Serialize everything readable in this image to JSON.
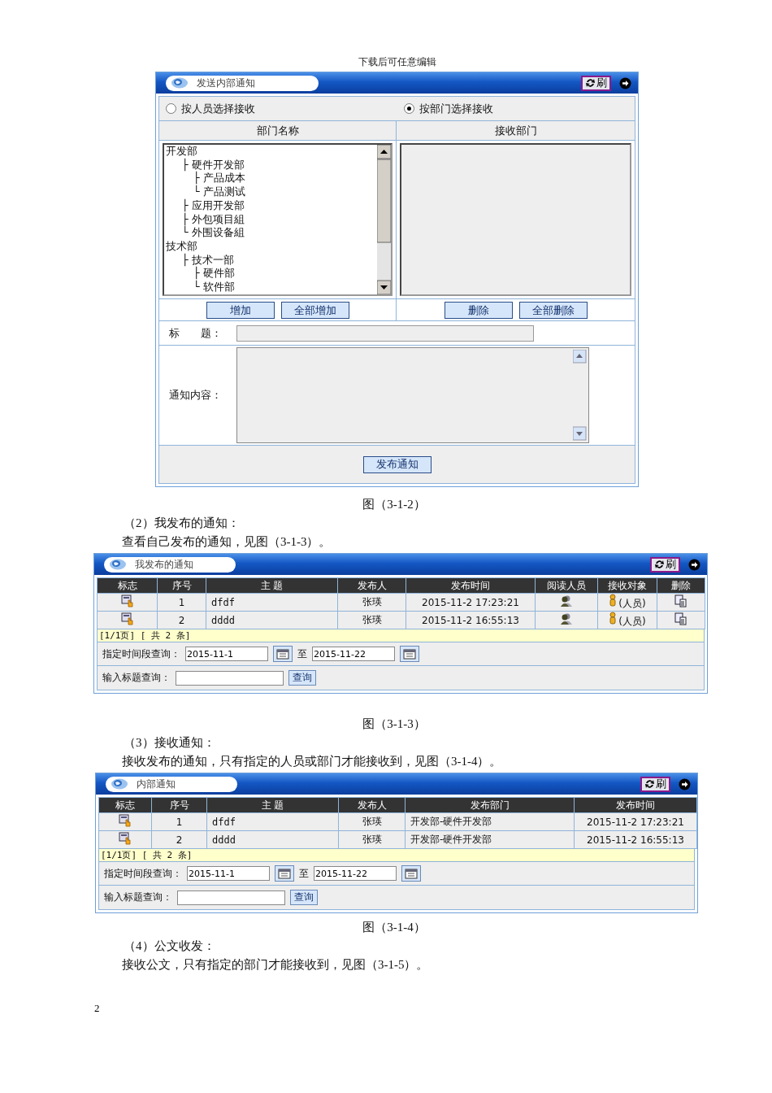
{
  "header_note": "下载后可任意编辑",
  "blocks": [
    {
      "kind": "send_form",
      "title": "发送内部通知",
      "refresh": "刷",
      "modes": [
        {
          "label": "按人员选择接收",
          "selected": false
        },
        {
          "label": "按部门选择接收",
          "selected": true
        }
      ],
      "columns": [
        "部门名称",
        "接收部门"
      ],
      "tree": [
        {
          "label": "开发部",
          "children": [
            {
              "label": "├ 硬件开发部",
              "children": [
                {
                  "label": "├ 产品成本"
                },
                {
                  "label": "└ 产品测试"
                }
              ]
            },
            {
              "label": "├ 应用开发部"
            },
            {
              "label": "├ 外包项目組"
            },
            {
              "label": "└ 外围设备組"
            }
          ]
        },
        {
          "label": "技术部",
          "children": [
            {
              "label": "├ 技术一部",
              "children": [
                {
                  "label": "├ 硬件部"
                },
                {
                  "label": "└ 软件部"
                }
              ]
            }
          ]
        }
      ],
      "left_buttons": [
        "增加",
        "全部增加"
      ],
      "right_buttons": [
        "删除",
        "全部删除"
      ],
      "subject_label": "标　　题：",
      "content_label": "通知内容：",
      "submit": "发布通知"
    },
    {
      "kind": "caption",
      "text": "图（3-1-2）"
    },
    {
      "kind": "heading",
      "text": "（2）我发布的通知："
    },
    {
      "kind": "paragraph",
      "text": "查看自己发布的通知，见图（3-1-3）。"
    },
    {
      "kind": "sent_list",
      "title": "我发布的通知",
      "refresh": "刷",
      "columns": [
        "标志",
        "序号",
        "主 题",
        "发布人",
        "发布时间",
        "阅读人员",
        "接收对象",
        "删除"
      ],
      "rows": [
        [
          {
            "kind": "notice"
          },
          {
            "kind": "center",
            "text": "1"
          },
          {
            "kind": "mono",
            "text": "dfdf"
          },
          {
            "kind": "center",
            "text": "张瑛"
          },
          {
            "kind": "center",
            "text": "2015-11-2 17:23:21"
          },
          {
            "kind": "readers"
          },
          {
            "kind": "recipient",
            "text": "(人员)"
          },
          {
            "kind": "delete"
          }
        ],
        [
          {
            "kind": "notice"
          },
          {
            "kind": "center",
            "text": "2"
          },
          {
            "kind": "mono",
            "text": "dddd"
          },
          {
            "kind": "center",
            "text": "张瑛"
          },
          {
            "kind": "center",
            "text": "2015-11-2 16:55:13"
          },
          {
            "kind": "readers"
          },
          {
            "kind": "recipient",
            "text": "(人员)"
          },
          {
            "kind": "delete"
          }
        ]
      ],
      "pager": "[1/1页] [ 共 2 条]",
      "date_label": "指定时间段查询：",
      "date_from": "2015-11-1",
      "to": "至",
      "date_to": "2015-11-22",
      "query_label": "输入标题查询：",
      "query_button": "查询"
    },
    {
      "kind": "caption",
      "text": "图（3-1-3）"
    },
    {
      "kind": "heading",
      "text": "（3）接收通知："
    },
    {
      "kind": "paragraph",
      "text": "接收发布的通知，只有指定的人员或部门才能接收到，见图（3-1-4）。"
    },
    {
      "kind": "inbox_list",
      "title": "内部通知",
      "refresh": "刷",
      "columns": [
        "标志",
        "序号",
        "主 题",
        "发布人",
        "发布部门",
        "发布时间"
      ],
      "rows": [
        [
          {
            "kind": "notice"
          },
          {
            "kind": "center",
            "text": "1"
          },
          {
            "kind": "mono",
            "text": "dfdf"
          },
          {
            "kind": "center",
            "text": "张瑛"
          },
          {
            "kind": "left",
            "text": "开发部-硬件开发部"
          },
          {
            "kind": "center",
            "text": "2015-11-2 17:23:21"
          }
        ],
        [
          {
            "kind": "notice"
          },
          {
            "kind": "center",
            "text": "2"
          },
          {
            "kind": "mono",
            "text": "dddd"
          },
          {
            "kind": "center",
            "text": "张瑛"
          },
          {
            "kind": "left",
            "text": "开发部-硬件开发部"
          },
          {
            "kind": "center",
            "text": "2015-11-2 16:55:13"
          }
        ]
      ],
      "pager": "[1/1页] [ 共 2 条]",
      "date_label": "指定时间段查询：",
      "date_from": "2015-11-1",
      "to": "至",
      "date_to": "2015-11-22",
      "query_label": "输入标题查询：",
      "query_button": "查询"
    },
    {
      "kind": "caption",
      "text": "图（3-1-4）"
    },
    {
      "kind": "heading",
      "text": "（4）公文收发："
    },
    {
      "kind": "paragraph",
      "text": "接收公文，只有指定的部门才能接收到，见图（3-1-5）。"
    }
  ],
  "page_number": "2"
}
